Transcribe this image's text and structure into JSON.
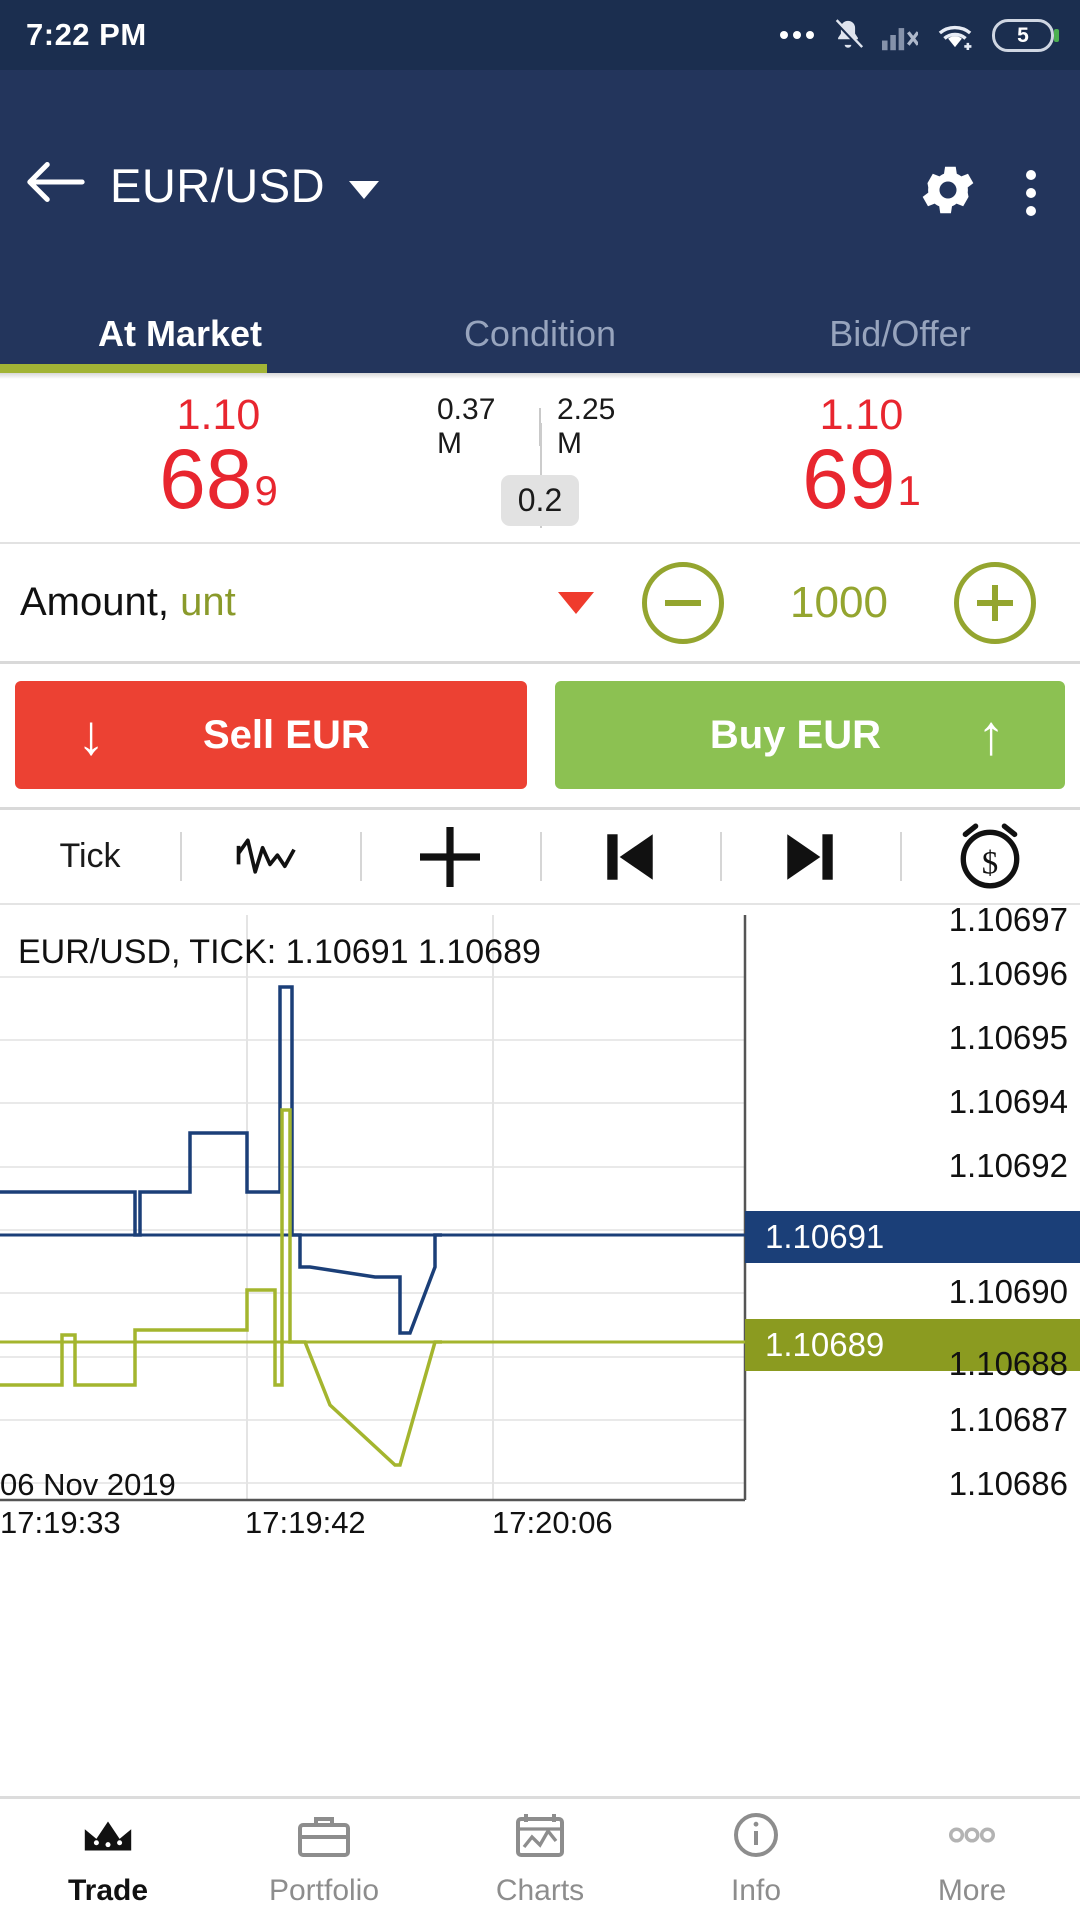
{
  "status_bar": {
    "time": "7:22 PM",
    "battery_level": "5",
    "icons": [
      "more-dots-icon",
      "bell-muted-icon",
      "signal-off-icon",
      "wifi-icon",
      "battery-icon"
    ]
  },
  "app_bar": {
    "back_icon": "back-arrow-icon",
    "title": "EUR/USD",
    "dropdown_icon": "chevron-down-icon",
    "settings_icon": "gear-icon",
    "overflow_icon": "kebab-menu-icon"
  },
  "tabs": [
    {
      "label": "At Market",
      "active": true
    },
    {
      "label": "Condition",
      "active": false
    },
    {
      "label": "Bid/Offer",
      "active": false
    }
  ],
  "quote": {
    "bid": {
      "big": "1.10",
      "main": "68",
      "sub": "9",
      "color": "#e8262f"
    },
    "ask": {
      "big": "1.10",
      "main": "69",
      "sub": "1",
      "color": "#e8262f"
    },
    "volume_left": "0.37 M",
    "volume_right": "2.25 M",
    "spread": "0.2"
  },
  "amount": {
    "label": "Amount,",
    "unit": "unt",
    "value": "1000",
    "minus_icon": "minus-circle-icon",
    "plus_icon": "plus-circle-icon",
    "dropdown_icon": "caret-down-icon"
  },
  "actions": {
    "sell_label": "Sell EUR",
    "sell_arrow": "↓",
    "sell_color": "#ec4133",
    "buy_label": "Buy EUR",
    "buy_arrow": "↑",
    "buy_color": "#8cc152"
  },
  "chart_toolbar": [
    {
      "label": "Tick",
      "icon": "tick-label"
    },
    {
      "label": "",
      "icon": "line-chart-icon"
    },
    {
      "label": "",
      "icon": "crosshair-plus-icon"
    },
    {
      "label": "",
      "icon": "skip-previous-icon"
    },
    {
      "label": "",
      "icon": "skip-next-icon"
    },
    {
      "label": "",
      "icon": "price-alert-clock-icon"
    }
  ],
  "chart_data": {
    "type": "line",
    "title": "EUR/USD, TICK: 1.10691 1.10689",
    "date_label": "06 Nov 2019",
    "xlabel": "",
    "ylabel": "",
    "grid": true,
    "legend_position": "none",
    "ylim": [
      1.10685,
      1.106975
    ],
    "y_ticks": [
      "1.10697",
      "1.10696",
      "1.10695",
      "1.10694",
      "1.10692",
      "1.10691",
      "1.10690",
      "1.10689",
      "1.10688",
      "1.10687",
      "1.10686"
    ],
    "x_ticks": [
      "17:19:33",
      "17:19:42",
      "17:20:06"
    ],
    "current_price_labels": [
      {
        "value": "1.10691",
        "series": "ask",
        "color": "#1b3f78"
      },
      {
        "value": "1.10689",
        "series": "bid",
        "color": "#8b9b20"
      }
    ],
    "series": [
      {
        "name": "ask",
        "color": "#1b3f78",
        "values": [
          1.10692,
          1.10692,
          1.10691,
          1.10692,
          1.10693,
          1.10692,
          1.10692,
          1.10697,
          1.10691,
          1.10691,
          1.1069,
          1.1069,
          1.10689,
          1.10691,
          1.10691
        ]
      },
      {
        "name": "bid",
        "color": "#a4b52e",
        "values": [
          1.10689,
          1.1069,
          1.10688,
          1.1069,
          1.1069,
          1.1069,
          1.10691,
          1.10695,
          1.10689,
          1.10689,
          1.10688,
          1.10687,
          1.10686,
          1.10689,
          1.10689
        ]
      }
    ]
  },
  "bottom_nav": [
    {
      "label": "Trade",
      "icon": "trade-crown-icon",
      "active": true
    },
    {
      "label": "Portfolio",
      "icon": "briefcase-icon",
      "active": false
    },
    {
      "label": "Charts",
      "icon": "chart-icon",
      "active": false
    },
    {
      "label": "Info",
      "icon": "info-circle-icon",
      "active": false
    },
    {
      "label": "More",
      "icon": "more-dots-icon",
      "active": false
    }
  ]
}
